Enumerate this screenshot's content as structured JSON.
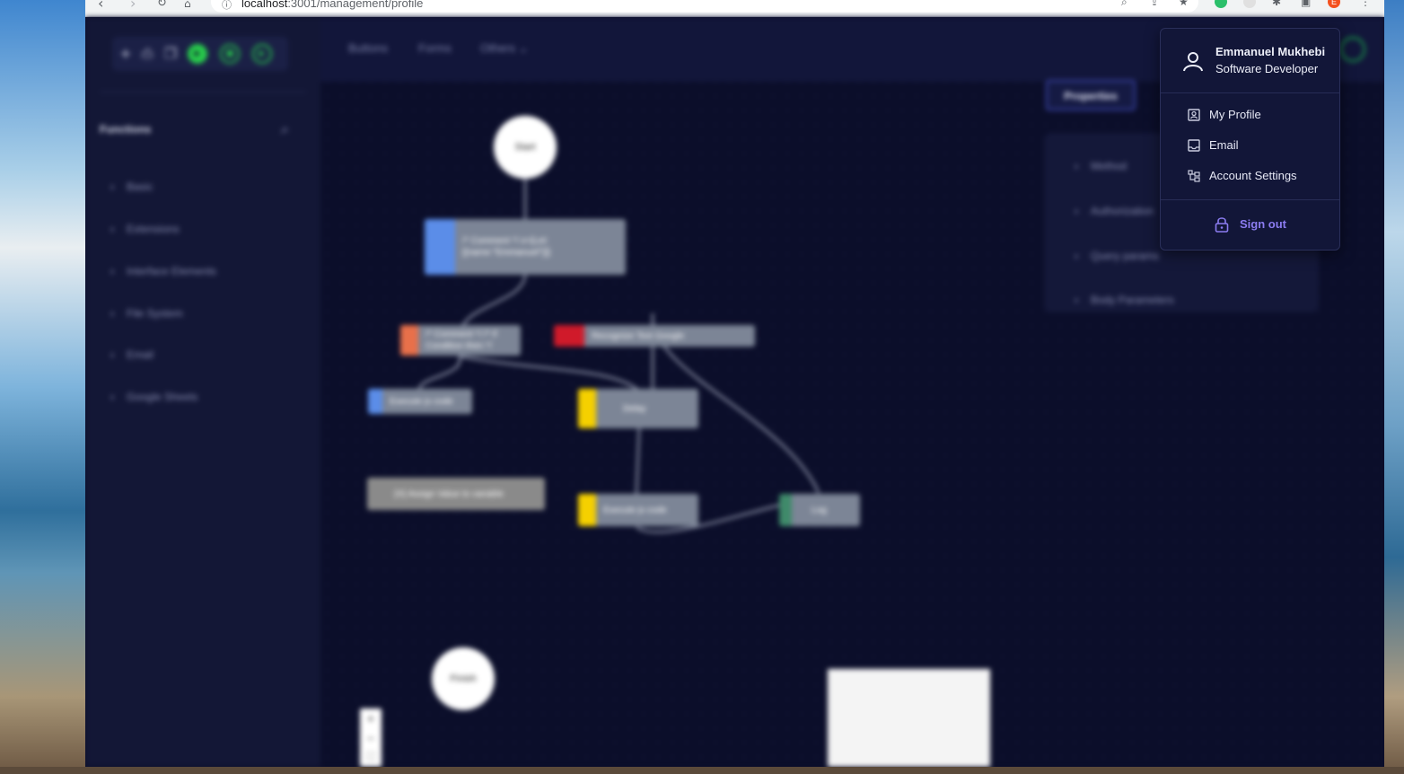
{
  "browser": {
    "url_host": "localhost",
    "url_rest": ":3001/management/profile",
    "profile_initial": "E"
  },
  "sidebar": {
    "title": "Functions",
    "items": [
      {
        "label": "Basic"
      },
      {
        "label": "Extensions"
      },
      {
        "label": "Interface Elements"
      },
      {
        "label": "File System"
      },
      {
        "label": "Email"
      },
      {
        "label": "Google Sheets"
      }
    ]
  },
  "topnav": {
    "buttons_label": "Buttons",
    "forms_label": "Forms",
    "others_label": "Others"
  },
  "flow": {
    "start": "Start",
    "finish": "Finish",
    "nodes": [
      {
        "label": "/* Comment */ x={Let: [{name:\"Emmanuel\"}]}",
        "color": "#5b8de8"
      },
      {
        "label": "/* Comment */ /* if Condition then */",
        "color": "#e8704a"
      },
      {
        "label": "Recognize Text Google",
        "color": "#d01a2a"
      },
      {
        "label": "Execute js code",
        "color": "#5b8de8"
      },
      {
        "label": "Delay",
        "color": "#f5d000"
      },
      {
        "label": "{X} Assign Value to variable",
        "color": "#8a8a8a"
      },
      {
        "label": "Execute js code",
        "color": "#f5d000"
      },
      {
        "label": "Log",
        "color": "#3f8a6a"
      }
    ]
  },
  "properties": {
    "tab_label": "Properties",
    "rows": [
      {
        "label": "Method"
      },
      {
        "label": "Authorization"
      },
      {
        "label": "Query params"
      },
      {
        "label": "Body Parameters"
      }
    ]
  },
  "profile_menu": {
    "name": "Emmanuel Mukhebi",
    "role": "Software Developer",
    "items": [
      {
        "label": "My Profile",
        "icon": "profile-card-icon"
      },
      {
        "label": "Email",
        "icon": "inbox-icon"
      },
      {
        "label": "Account Settings",
        "icon": "sitemap-icon"
      }
    ],
    "sign_out": "Sign out",
    "accent": "#8b7cf0"
  }
}
